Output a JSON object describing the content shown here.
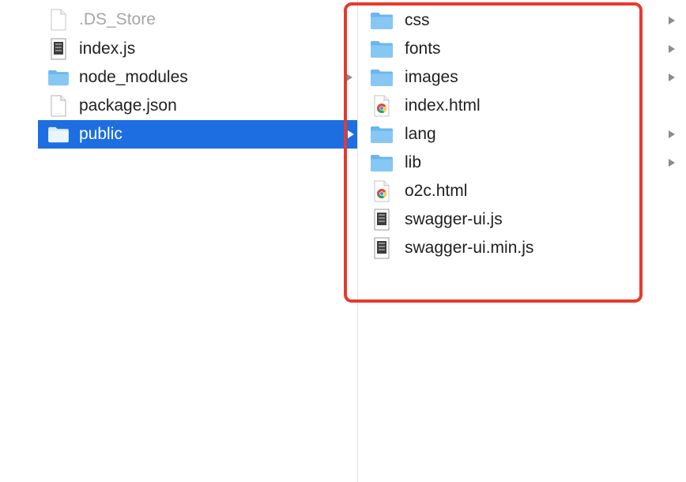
{
  "column1": {
    "items": [
      {
        "label": ".DS_Store",
        "icon": "blank-file-icon"
      },
      {
        "label": "index.js",
        "icon": "script-file-icon"
      },
      {
        "label": "node_modules",
        "icon": "folder-icon"
      },
      {
        "label": "package.json",
        "icon": "text-file-icon"
      },
      {
        "label": "public",
        "icon": "folder-icon",
        "selected": true
      }
    ]
  },
  "column2": {
    "items": [
      {
        "label": "css",
        "icon": "folder-icon"
      },
      {
        "label": "fonts",
        "icon": "folder-icon"
      },
      {
        "label": "images",
        "icon": "folder-icon"
      },
      {
        "label": "index.html",
        "icon": "chrome-html-file-icon"
      },
      {
        "label": "lang",
        "icon": "folder-icon"
      },
      {
        "label": "lib",
        "icon": "folder-icon"
      },
      {
        "label": "o2c.html",
        "icon": "chrome-html-file-icon"
      },
      {
        "label": "swagger-ui.js",
        "icon": "script-file-icon"
      },
      {
        "label": "swagger-ui.min.js",
        "icon": "script-file-icon"
      }
    ]
  },
  "colors": {
    "selection": "#1d6ee0",
    "highlight_border": "#e8392c",
    "folder": "#74bdf2"
  }
}
